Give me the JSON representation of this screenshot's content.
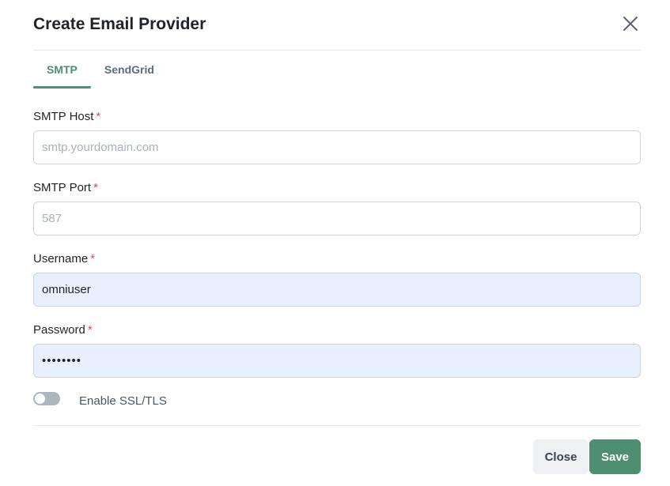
{
  "dialog": {
    "title": "Create Email Provider"
  },
  "tabs": [
    {
      "label": "SMTP",
      "active": true
    },
    {
      "label": "SendGrid",
      "active": false
    }
  ],
  "fields": {
    "smtp_host": {
      "label": "SMTP Host",
      "required_mark": "*",
      "placeholder": "smtp.yourdomain.com",
      "value": ""
    },
    "smtp_port": {
      "label": "SMTP Port",
      "required_mark": "*",
      "placeholder": "587",
      "value": ""
    },
    "username": {
      "label": "Username",
      "required_mark": "*",
      "value": "omniuser"
    },
    "password": {
      "label": "Password",
      "required_mark": "*",
      "value": "••••••••"
    }
  },
  "ssl_toggle": {
    "label": "Enable SSL/TLS",
    "enabled": false
  },
  "footer": {
    "close_label": "Close",
    "save_label": "Save"
  },
  "colors": {
    "accent": "#4d8f6e",
    "required": "#e5484d",
    "autofill_bg": "#e8f0fe"
  },
  "icons": {
    "close": "close-icon"
  }
}
